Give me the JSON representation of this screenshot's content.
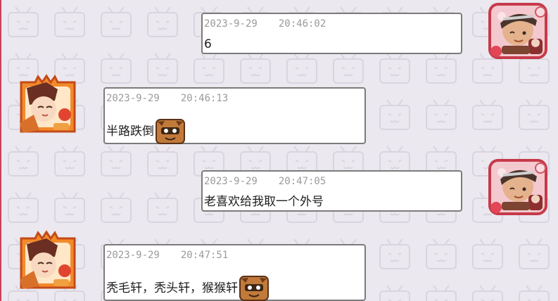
{
  "chat": {
    "messages": [
      {
        "side": "right",
        "date": "2023-9-29",
        "time": "20:46:02",
        "text": "6",
        "emote": null
      },
      {
        "side": "left",
        "date": "2023-9-29",
        "time": "20:46:13",
        "text": "半路跌倒",
        "emote": "bear-face-emote"
      },
      {
        "side": "right",
        "date": "2023-9-29",
        "time": "20:47:05",
        "text": "老喜欢给我取一个外号",
        "emote": null
      },
      {
        "side": "left",
        "date": "2023-9-29",
        "time": "20:47:51",
        "text": "秃毛轩，秃头轩，猴猴轩",
        "emote": "bear-face-emote"
      }
    ]
  },
  "colors": {
    "background": "#ebe8ef",
    "bubble_border": "#7b7b7b",
    "timestamp": "#9a9a9a",
    "message_text": "#1e1e1e",
    "accent_edge": "#c7425a"
  }
}
